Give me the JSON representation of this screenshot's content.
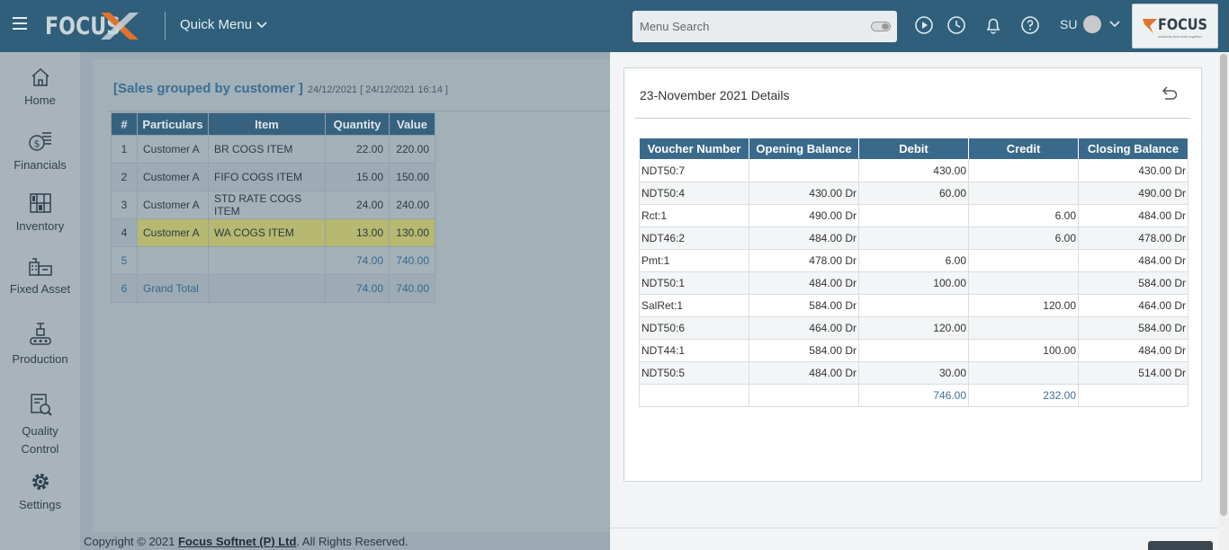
{
  "header": {
    "logo_text": "FOCUS",
    "quick_menu_label": "Quick Menu",
    "search_placeholder": "Menu Search",
    "user_initials": "SU",
    "brand_text": "FOCUS",
    "brand_tagline": "solutions that work together",
    "icons": [
      "menu-icon",
      "play-icon",
      "clock-icon",
      "bell-icon",
      "help-icon",
      "avatar",
      "chevron-down-icon"
    ]
  },
  "sidebar": {
    "items": [
      {
        "label": "Home",
        "icon": "home-icon"
      },
      {
        "label": "Financials",
        "icon": "coins-icon"
      },
      {
        "label": "Inventory",
        "icon": "inventory-icon"
      },
      {
        "label": "Fixed Asset",
        "icon": "fixed-asset-icon"
      },
      {
        "label": "Production",
        "icon": "production-icon"
      },
      {
        "label": "Quality Control",
        "line1": "Quality",
        "line2": "Control",
        "icon": "quality-control-icon"
      },
      {
        "label": "Settings",
        "icon": "gear-icon"
      }
    ]
  },
  "report": {
    "title": "[Sales grouped by customer ]",
    "date": "24/12/2021 [ 24/12/2021 16:14 ]",
    "columns": [
      "#",
      "Particulars",
      "Item",
      "Quantity",
      "Value"
    ],
    "rows": [
      {
        "n": "1",
        "particulars": "Customer A",
        "item": "BR COGS ITEM",
        "quantity": "22.00",
        "value": "220.00"
      },
      {
        "n": "2",
        "particulars": "Customer A",
        "item": "FIFO COGS ITEM",
        "quantity": "15.00",
        "value": "150.00"
      },
      {
        "n": "3",
        "particulars": "Customer A",
        "item": "STD RATE COGS ITEM",
        "quantity": "24.00",
        "value": "240.00"
      },
      {
        "n": "4",
        "particulars": "Customer A",
        "item": "WA COGS ITEM",
        "quantity": "13.00",
        "value": "130.00"
      },
      {
        "n": "5",
        "particulars": "",
        "item": "",
        "quantity": "74.00",
        "value": "740.00"
      },
      {
        "n": "6",
        "particulars": "Grand Total",
        "item": "",
        "quantity": "74.00",
        "value": "740.00"
      }
    ],
    "highlighted_row": 4,
    "highlight_color": "#b6b96f"
  },
  "details": {
    "title": "23-November 2021 Details",
    "columns": [
      "Voucher Number",
      "Opening Balance",
      "Debit",
      "Credit",
      "Closing Balance"
    ],
    "rows": [
      {
        "voucher": "NDT50:7",
        "opening": "",
        "debit": "430.00",
        "credit": "",
        "closing": "430.00 Dr"
      },
      {
        "voucher": "NDT50:4",
        "opening": "430.00 Dr",
        "debit": "60.00",
        "credit": "",
        "closing": "490.00 Dr"
      },
      {
        "voucher": "Rct:1",
        "opening": "490.00 Dr",
        "debit": "",
        "credit": "6.00",
        "closing": "484.00 Dr"
      },
      {
        "voucher": "NDT46:2",
        "opening": "484.00 Dr",
        "debit": "",
        "credit": "6.00",
        "closing": "478.00 Dr"
      },
      {
        "voucher": "Pmt:1",
        "opening": "478.00 Dr",
        "debit": "6.00",
        "credit": "",
        "closing": "484.00 Dr"
      },
      {
        "voucher": "NDT50:1",
        "opening": "484.00 Dr",
        "debit": "100.00",
        "credit": "",
        "closing": "584.00 Dr"
      },
      {
        "voucher": "SalRet:1",
        "opening": "584.00 Dr",
        "debit": "",
        "credit": "120.00",
        "closing": "464.00 Dr"
      },
      {
        "voucher": "NDT50:6",
        "opening": "464.00 Dr",
        "debit": "120.00",
        "credit": "",
        "closing": "584.00 Dr"
      },
      {
        "voucher": "NDT44:1",
        "opening": "584.00 Dr",
        "debit": "",
        "credit": "100.00",
        "closing": "484.00 Dr"
      },
      {
        "voucher": "NDT50:5",
        "opening": "484.00 Dr",
        "debit": "30.00",
        "credit": "",
        "closing": "514.00 Dr"
      }
    ],
    "totals": {
      "debit": "746.00",
      "credit": "232.00"
    }
  },
  "footer": {
    "prefix": "Copyright © 2021 ",
    "company": "Focus Softnet (P) Ltd",
    "suffix": ". All Rights Reserved."
  },
  "colors": {
    "header_bg": "#2f5f7a",
    "table_header_bg": "#3a6a8b",
    "accent": "#3b6f93",
    "logo_x_orange": "#e0742c"
  }
}
